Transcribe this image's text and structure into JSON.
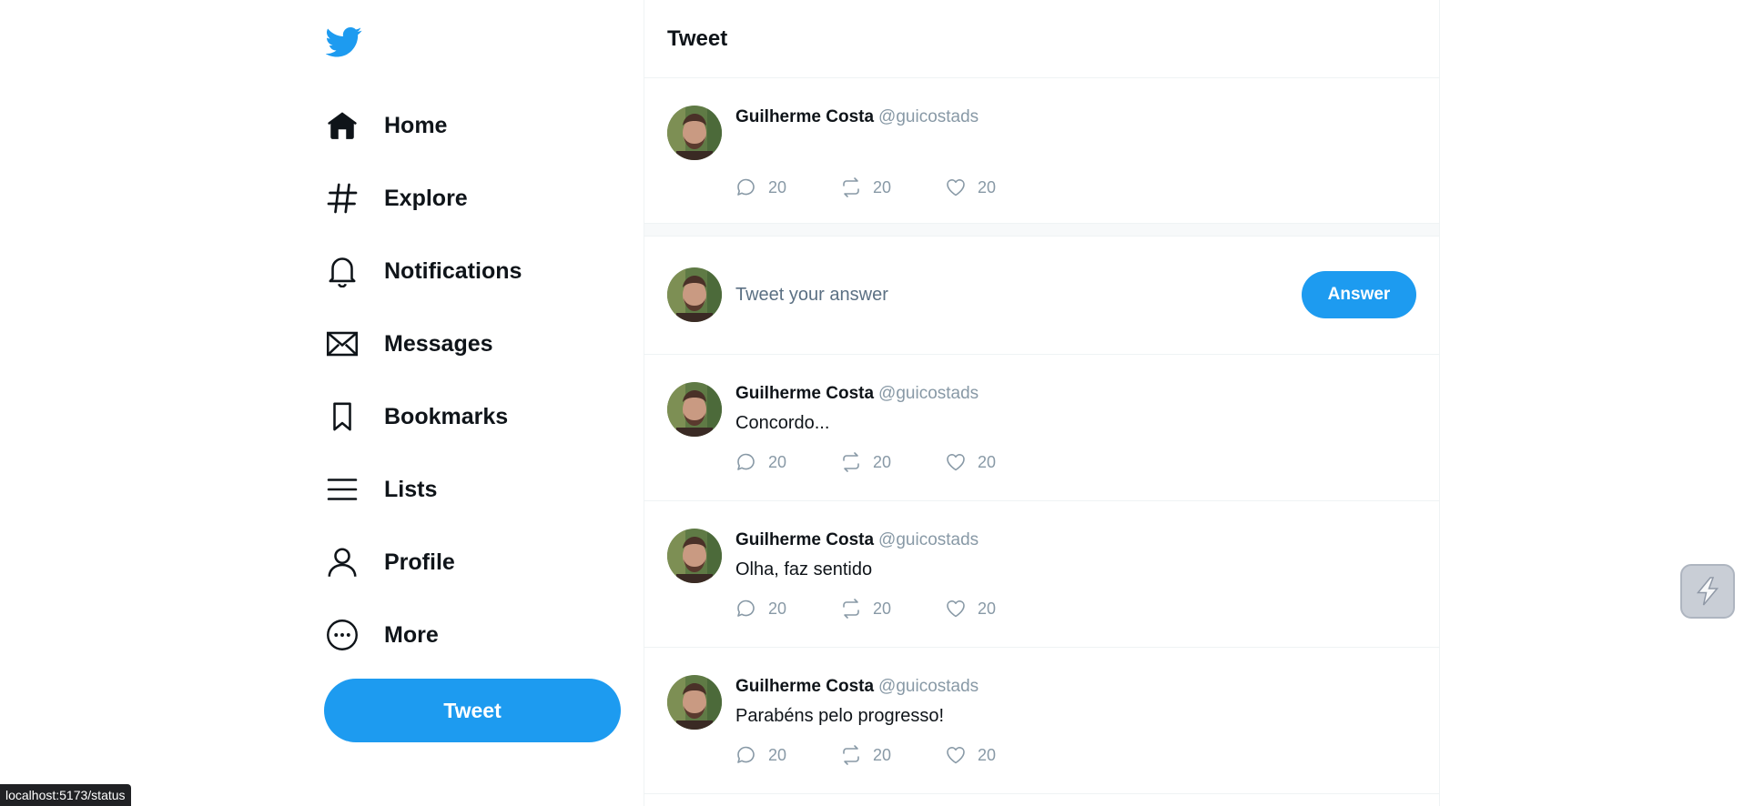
{
  "sidebar": {
    "logo_icon": "twitter-bird-icon",
    "items": [
      {
        "label": "Home",
        "icon": "home-icon"
      },
      {
        "label": "Explore",
        "icon": "hashtag-icon"
      },
      {
        "label": "Notifications",
        "icon": "bell-icon"
      },
      {
        "label": "Messages",
        "icon": "envelope-icon"
      },
      {
        "label": "Bookmarks",
        "icon": "bookmark-icon"
      },
      {
        "label": "Lists",
        "icon": "list-icon"
      },
      {
        "label": "Profile",
        "icon": "user-icon"
      },
      {
        "label": "More",
        "icon": "more-circle-icon"
      }
    ],
    "tweet_button": "Tweet"
  },
  "main": {
    "title": "Tweet",
    "original_post": {
      "name": "Guilherme Costa",
      "handle": "@guicostads",
      "comments": "20",
      "retweets": "20",
      "likes": "20"
    },
    "compose": {
      "placeholder": "Tweet your answer",
      "button": "Answer"
    },
    "replies": [
      {
        "name": "Guilherme Costa",
        "handle": "@guicostads",
        "text": "Concordo...",
        "comments": "20",
        "retweets": "20",
        "likes": "20"
      },
      {
        "name": "Guilherme Costa",
        "handle": "@guicostads",
        "text": "Olha, faz sentido",
        "comments": "20",
        "retweets": "20",
        "likes": "20"
      },
      {
        "name": "Guilherme Costa",
        "handle": "@guicostads",
        "text": "Parabéns pelo progresso!",
        "comments": "20",
        "retweets": "20",
        "likes": "20"
      }
    ]
  },
  "status_bar": {
    "url": "localhost:5173/status"
  },
  "colors": {
    "accent": "#1d9bf0",
    "muted": "#8899a6",
    "text": "#0f1419"
  }
}
